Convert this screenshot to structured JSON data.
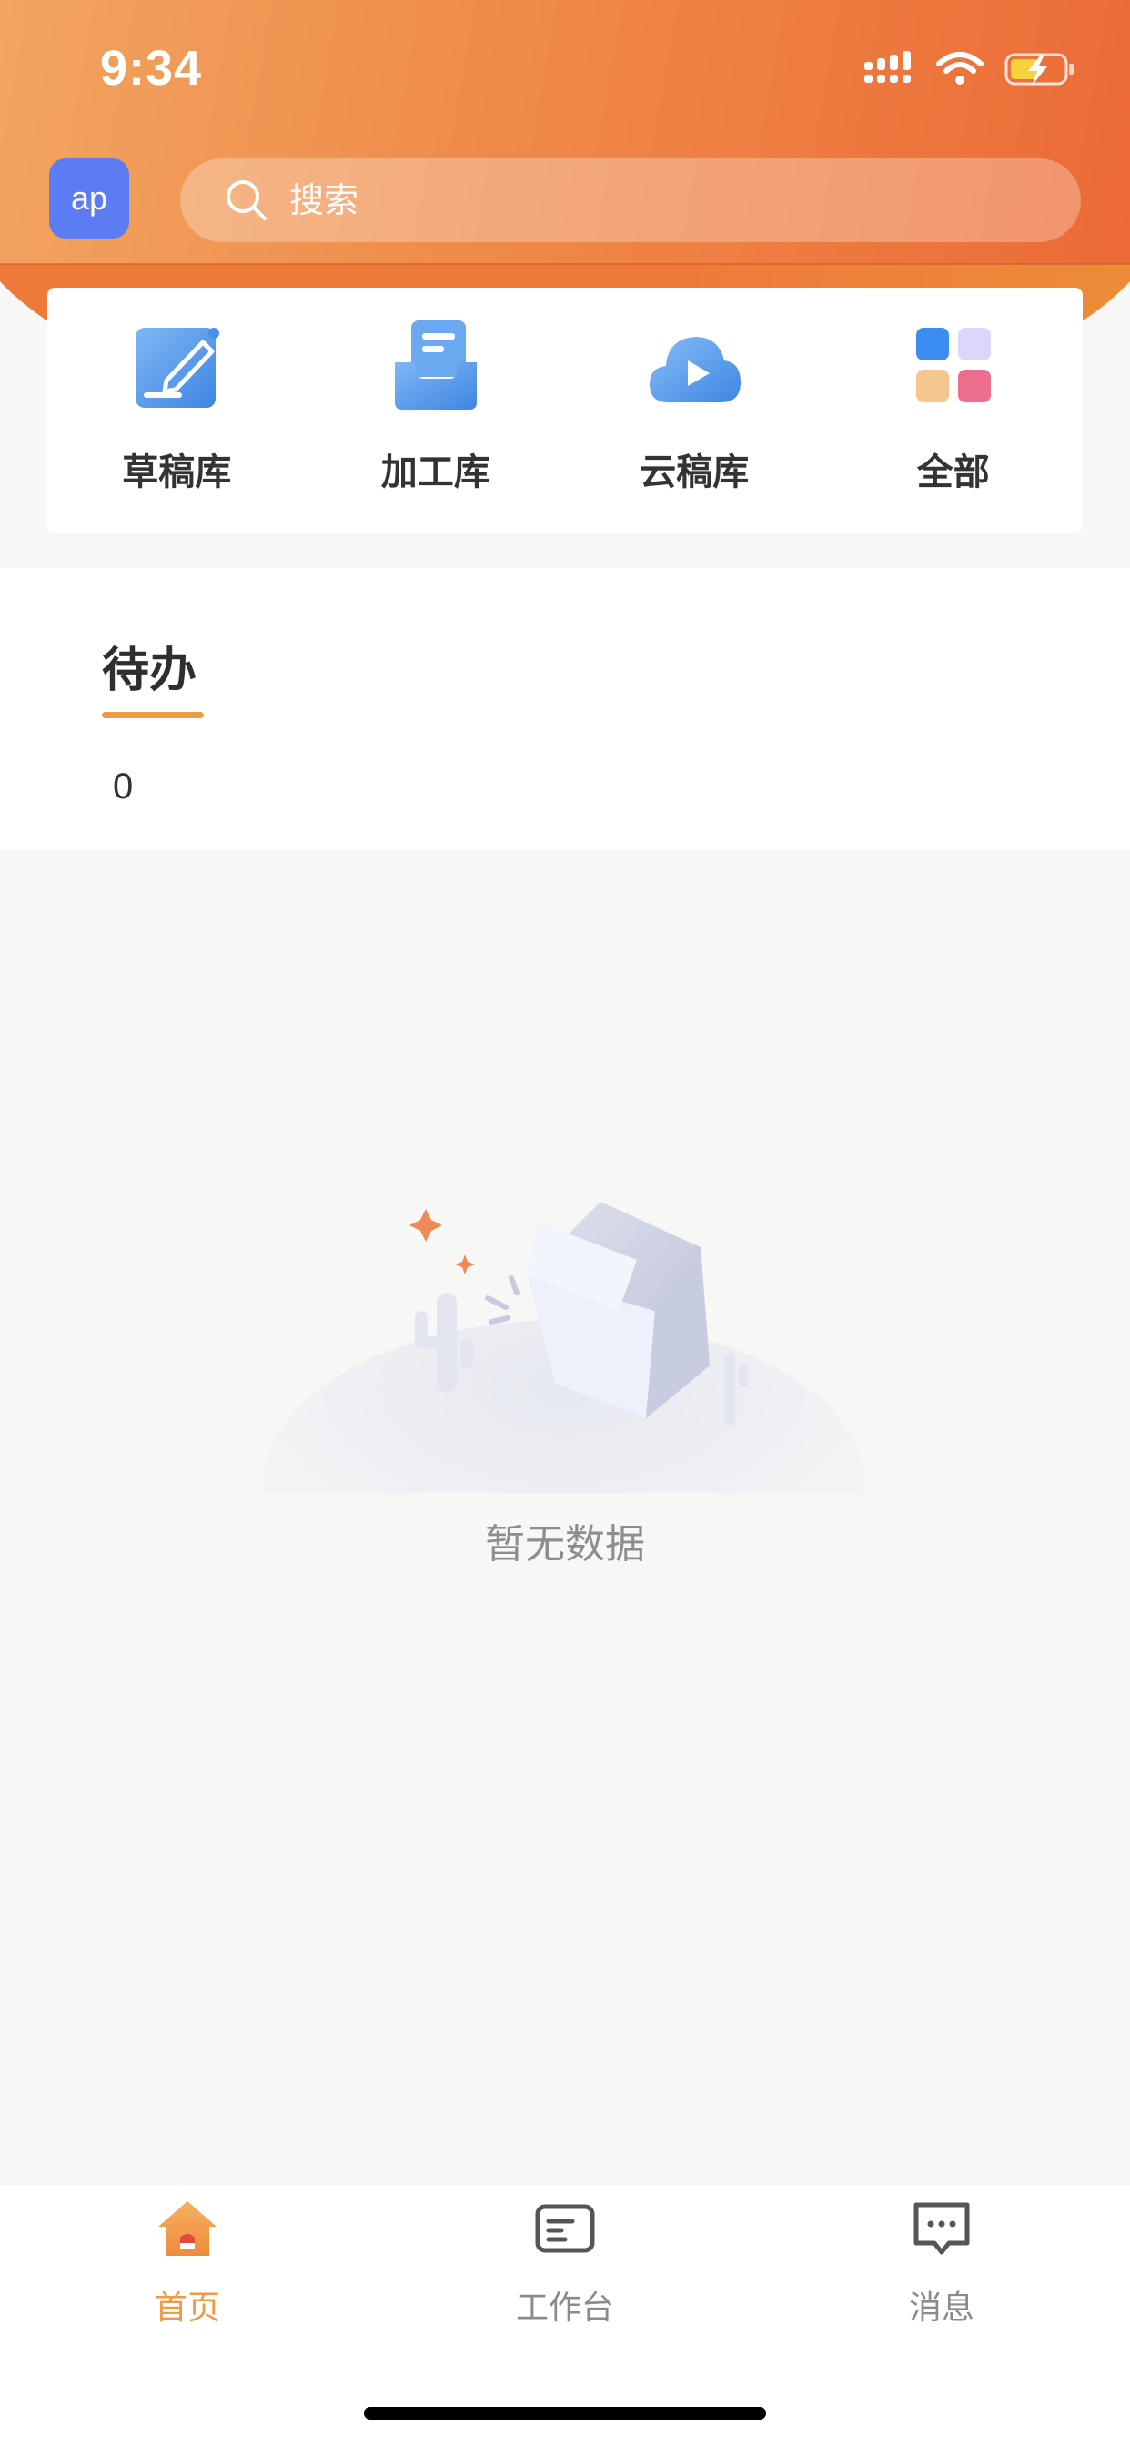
{
  "status_bar": {
    "time": "9:34"
  },
  "header": {
    "avatar_text": "ap",
    "search": {
      "placeholder": "搜索",
      "value": ""
    }
  },
  "quick_actions": [
    {
      "label": "草稿库",
      "icon": "draft-edit-icon"
    },
    {
      "label": "加工库",
      "icon": "processing-tray-icon"
    },
    {
      "label": "云稿库",
      "icon": "cloud-play-icon"
    },
    {
      "label": "全部",
      "icon": "all-apps-grid-icon"
    }
  ],
  "todo": {
    "tab_label": "待办",
    "count": "0"
  },
  "empty_state": {
    "message": "暂无数据",
    "illustration": "empty-box-cactus"
  },
  "bottom_nav": [
    {
      "label": "首页",
      "icon": "home-icon",
      "active": true
    },
    {
      "label": "工作台",
      "icon": "workbench-icon",
      "active": false
    },
    {
      "label": "消息",
      "icon": "message-icon",
      "active": false
    }
  ],
  "colors": {
    "header_gradient_start": "#f2a460",
    "header_gradient_end": "#ec6a36",
    "accent": "#ef9a45",
    "avatar": "#5b7cf2"
  }
}
